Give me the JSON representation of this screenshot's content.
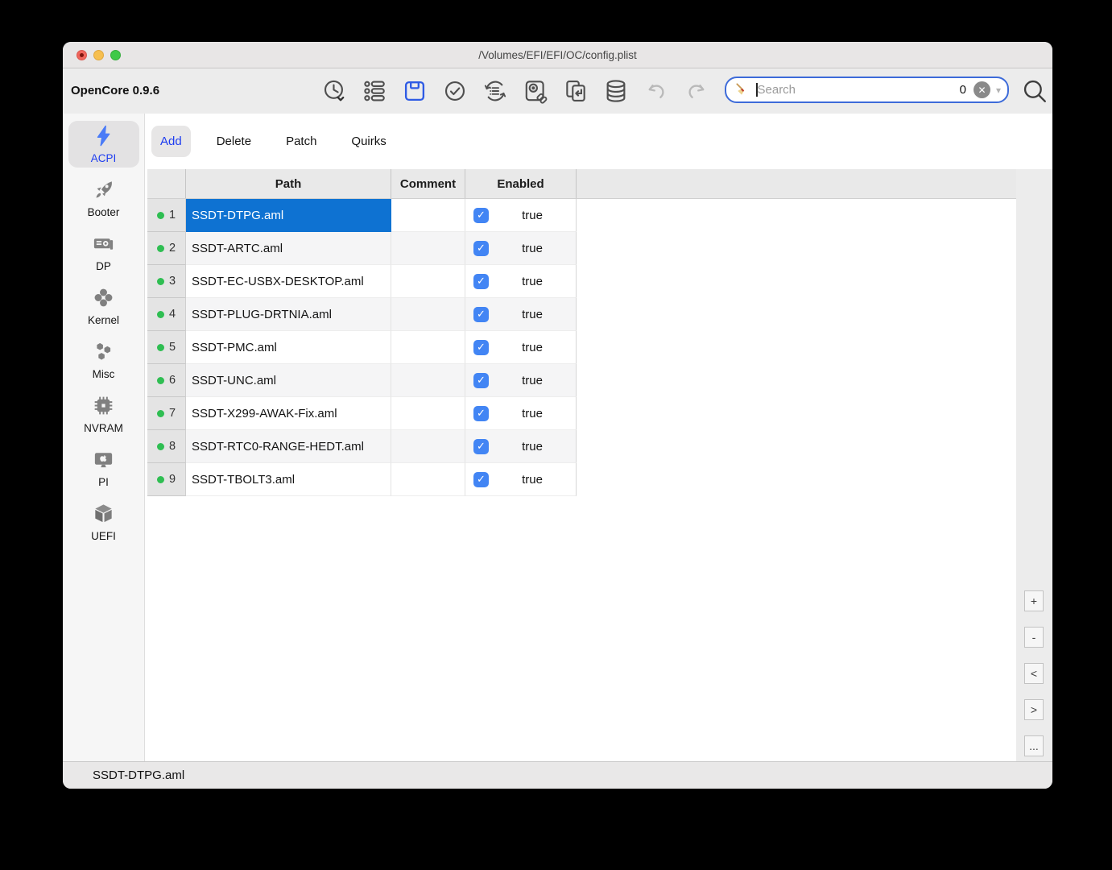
{
  "window": {
    "title": "/Volumes/EFI/EFI/OC/config.plist",
    "app_name": "OpenCore 0.9.6"
  },
  "toolbar": {
    "icon_names": [
      "history-icon",
      "list-icon",
      "save-icon",
      "validate-icon",
      "ocvalidate-icon",
      "mount-esp-icon",
      "sync-icon",
      "database-icon",
      "undo-icon",
      "redo-icon",
      "search-icon"
    ],
    "search": {
      "placeholder": "Search",
      "value": "",
      "match_count": "0"
    }
  },
  "sidebar": {
    "items": [
      {
        "label": "ACPI",
        "icon": "lightning-icon",
        "selected": true
      },
      {
        "label": "Booter",
        "icon": "rocket-icon",
        "selected": false
      },
      {
        "label": "DP",
        "icon": "gpu-icon",
        "selected": false
      },
      {
        "label": "Kernel",
        "icon": "clover-icon",
        "selected": false
      },
      {
        "label": "Misc",
        "icon": "hexagons-icon",
        "selected": false
      },
      {
        "label": "NVRAM",
        "icon": "chip-icon",
        "selected": false
      },
      {
        "label": "PI",
        "icon": "monitor-apple-icon",
        "selected": false
      },
      {
        "label": "UEFI",
        "icon": "cube-icon",
        "selected": false
      }
    ]
  },
  "tabs": [
    {
      "label": "Add",
      "selected": true
    },
    {
      "label": "Delete",
      "selected": false
    },
    {
      "label": "Patch",
      "selected": false
    },
    {
      "label": "Quirks",
      "selected": false
    }
  ],
  "table": {
    "columns": [
      "Path",
      "Comment",
      "Enabled"
    ],
    "rows": [
      {
        "num": "1",
        "path": "SSDT-DTPG.aml",
        "comment": "",
        "enabled": "true",
        "checked": true,
        "selected": true
      },
      {
        "num": "2",
        "path": "SSDT-ARTC.aml",
        "comment": "",
        "enabled": "true",
        "checked": true,
        "selected": false
      },
      {
        "num": "3",
        "path": "SSDT-EC-USBX-DESKTOP.aml",
        "comment": "",
        "enabled": "true",
        "checked": true,
        "selected": false
      },
      {
        "num": "4",
        "path": "SSDT-PLUG-DRTNIA.aml",
        "comment": "",
        "enabled": "true",
        "checked": true,
        "selected": false
      },
      {
        "num": "5",
        "path": "SSDT-PMC.aml",
        "comment": "",
        "enabled": "true",
        "checked": true,
        "selected": false
      },
      {
        "num": "6",
        "path": "SSDT-UNC.aml",
        "comment": "",
        "enabled": "true",
        "checked": true,
        "selected": false
      },
      {
        "num": "7",
        "path": "SSDT-X299-AWAK-Fix.aml",
        "comment": "",
        "enabled": "true",
        "checked": true,
        "selected": false
      },
      {
        "num": "8",
        "path": "SSDT-RTC0-RANGE-HEDT.aml",
        "comment": "",
        "enabled": "true",
        "checked": true,
        "selected": false
      },
      {
        "num": "9",
        "path": "SSDT-TBOLT3.aml",
        "comment": "",
        "enabled": "true",
        "checked": true,
        "selected": false
      }
    ]
  },
  "side_buttons": [
    "+",
    "-",
    "<",
    ">",
    "..."
  ],
  "statusbar": {
    "text": "SSDT-DTPG.aml"
  },
  "icons": {
    "check": "✓",
    "clear": "✕",
    "chevron_down": "▾"
  },
  "colors": {
    "accent_blue": "#1d3cf0",
    "selection_blue": "#0e72d2",
    "checkbox_blue": "#4285f4",
    "enabled_green": "#2fbe52",
    "save_blue": "#2e5be4"
  }
}
